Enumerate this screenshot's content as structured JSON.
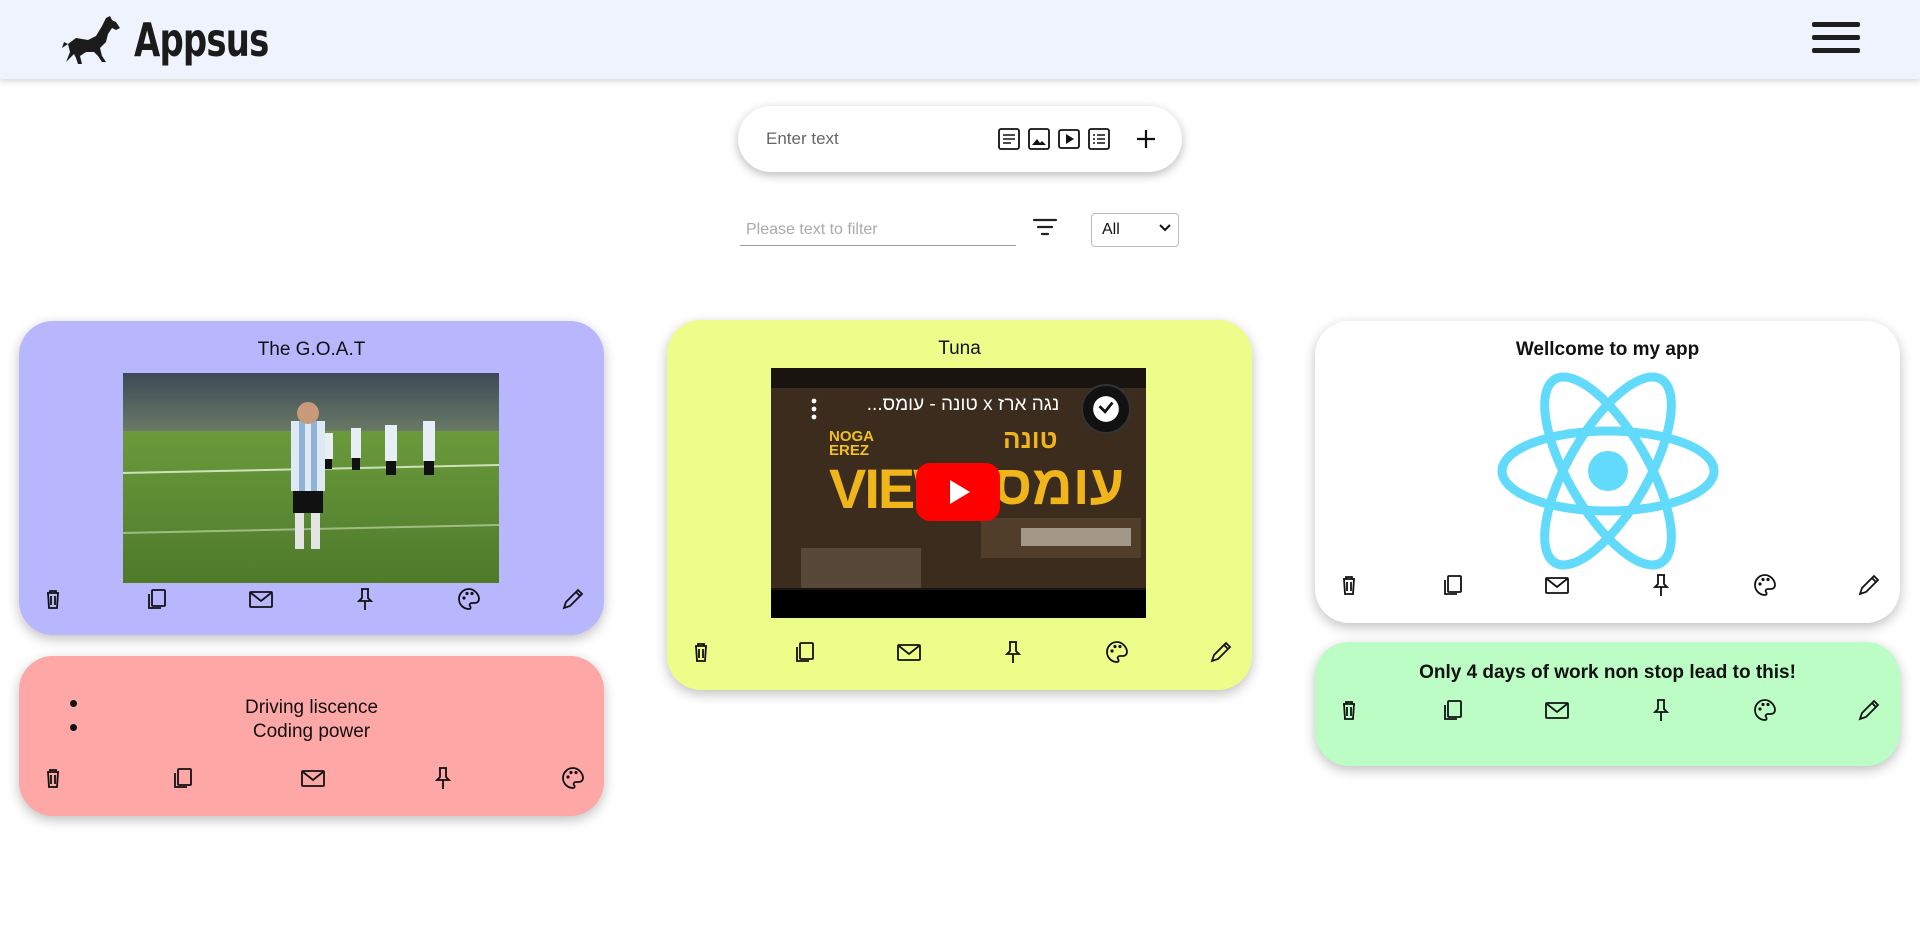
{
  "app": {
    "title": "Appsus"
  },
  "add_note": {
    "placeholder": "Enter text",
    "types": [
      "text-note-icon",
      "image-note-icon",
      "video-note-icon",
      "todo-note-icon"
    ]
  },
  "filter": {
    "placeholder": "Please text to filter",
    "select_value": "All"
  },
  "notes": [
    {
      "title": "The G.O.A.T",
      "type": "image",
      "color": "#b8b6fc"
    },
    {
      "title": "",
      "type": "todos",
      "color": "#fda7a7",
      "todos": [
        "Driving liscence",
        "Coding power"
      ]
    },
    {
      "title": "Tuna",
      "type": "video",
      "color": "#edfd8a",
      "video_title": "נגה ארז x טונה - עומס...",
      "video_overlay": [
        "NOGA",
        "EREZ",
        "VIEWS",
        "טונה",
        "עומס"
      ]
    },
    {
      "title": "Wellcome to my app",
      "type": "image",
      "color": "#ffffff"
    },
    {
      "title": "Only 4 days of work non stop lead to this!",
      "type": "text",
      "color": "#bcfcc5"
    }
  ],
  "note_actions": [
    "trash-icon",
    "duplicate-icon",
    "mail-icon",
    "pin-icon",
    "palette-icon",
    "edit-icon"
  ]
}
